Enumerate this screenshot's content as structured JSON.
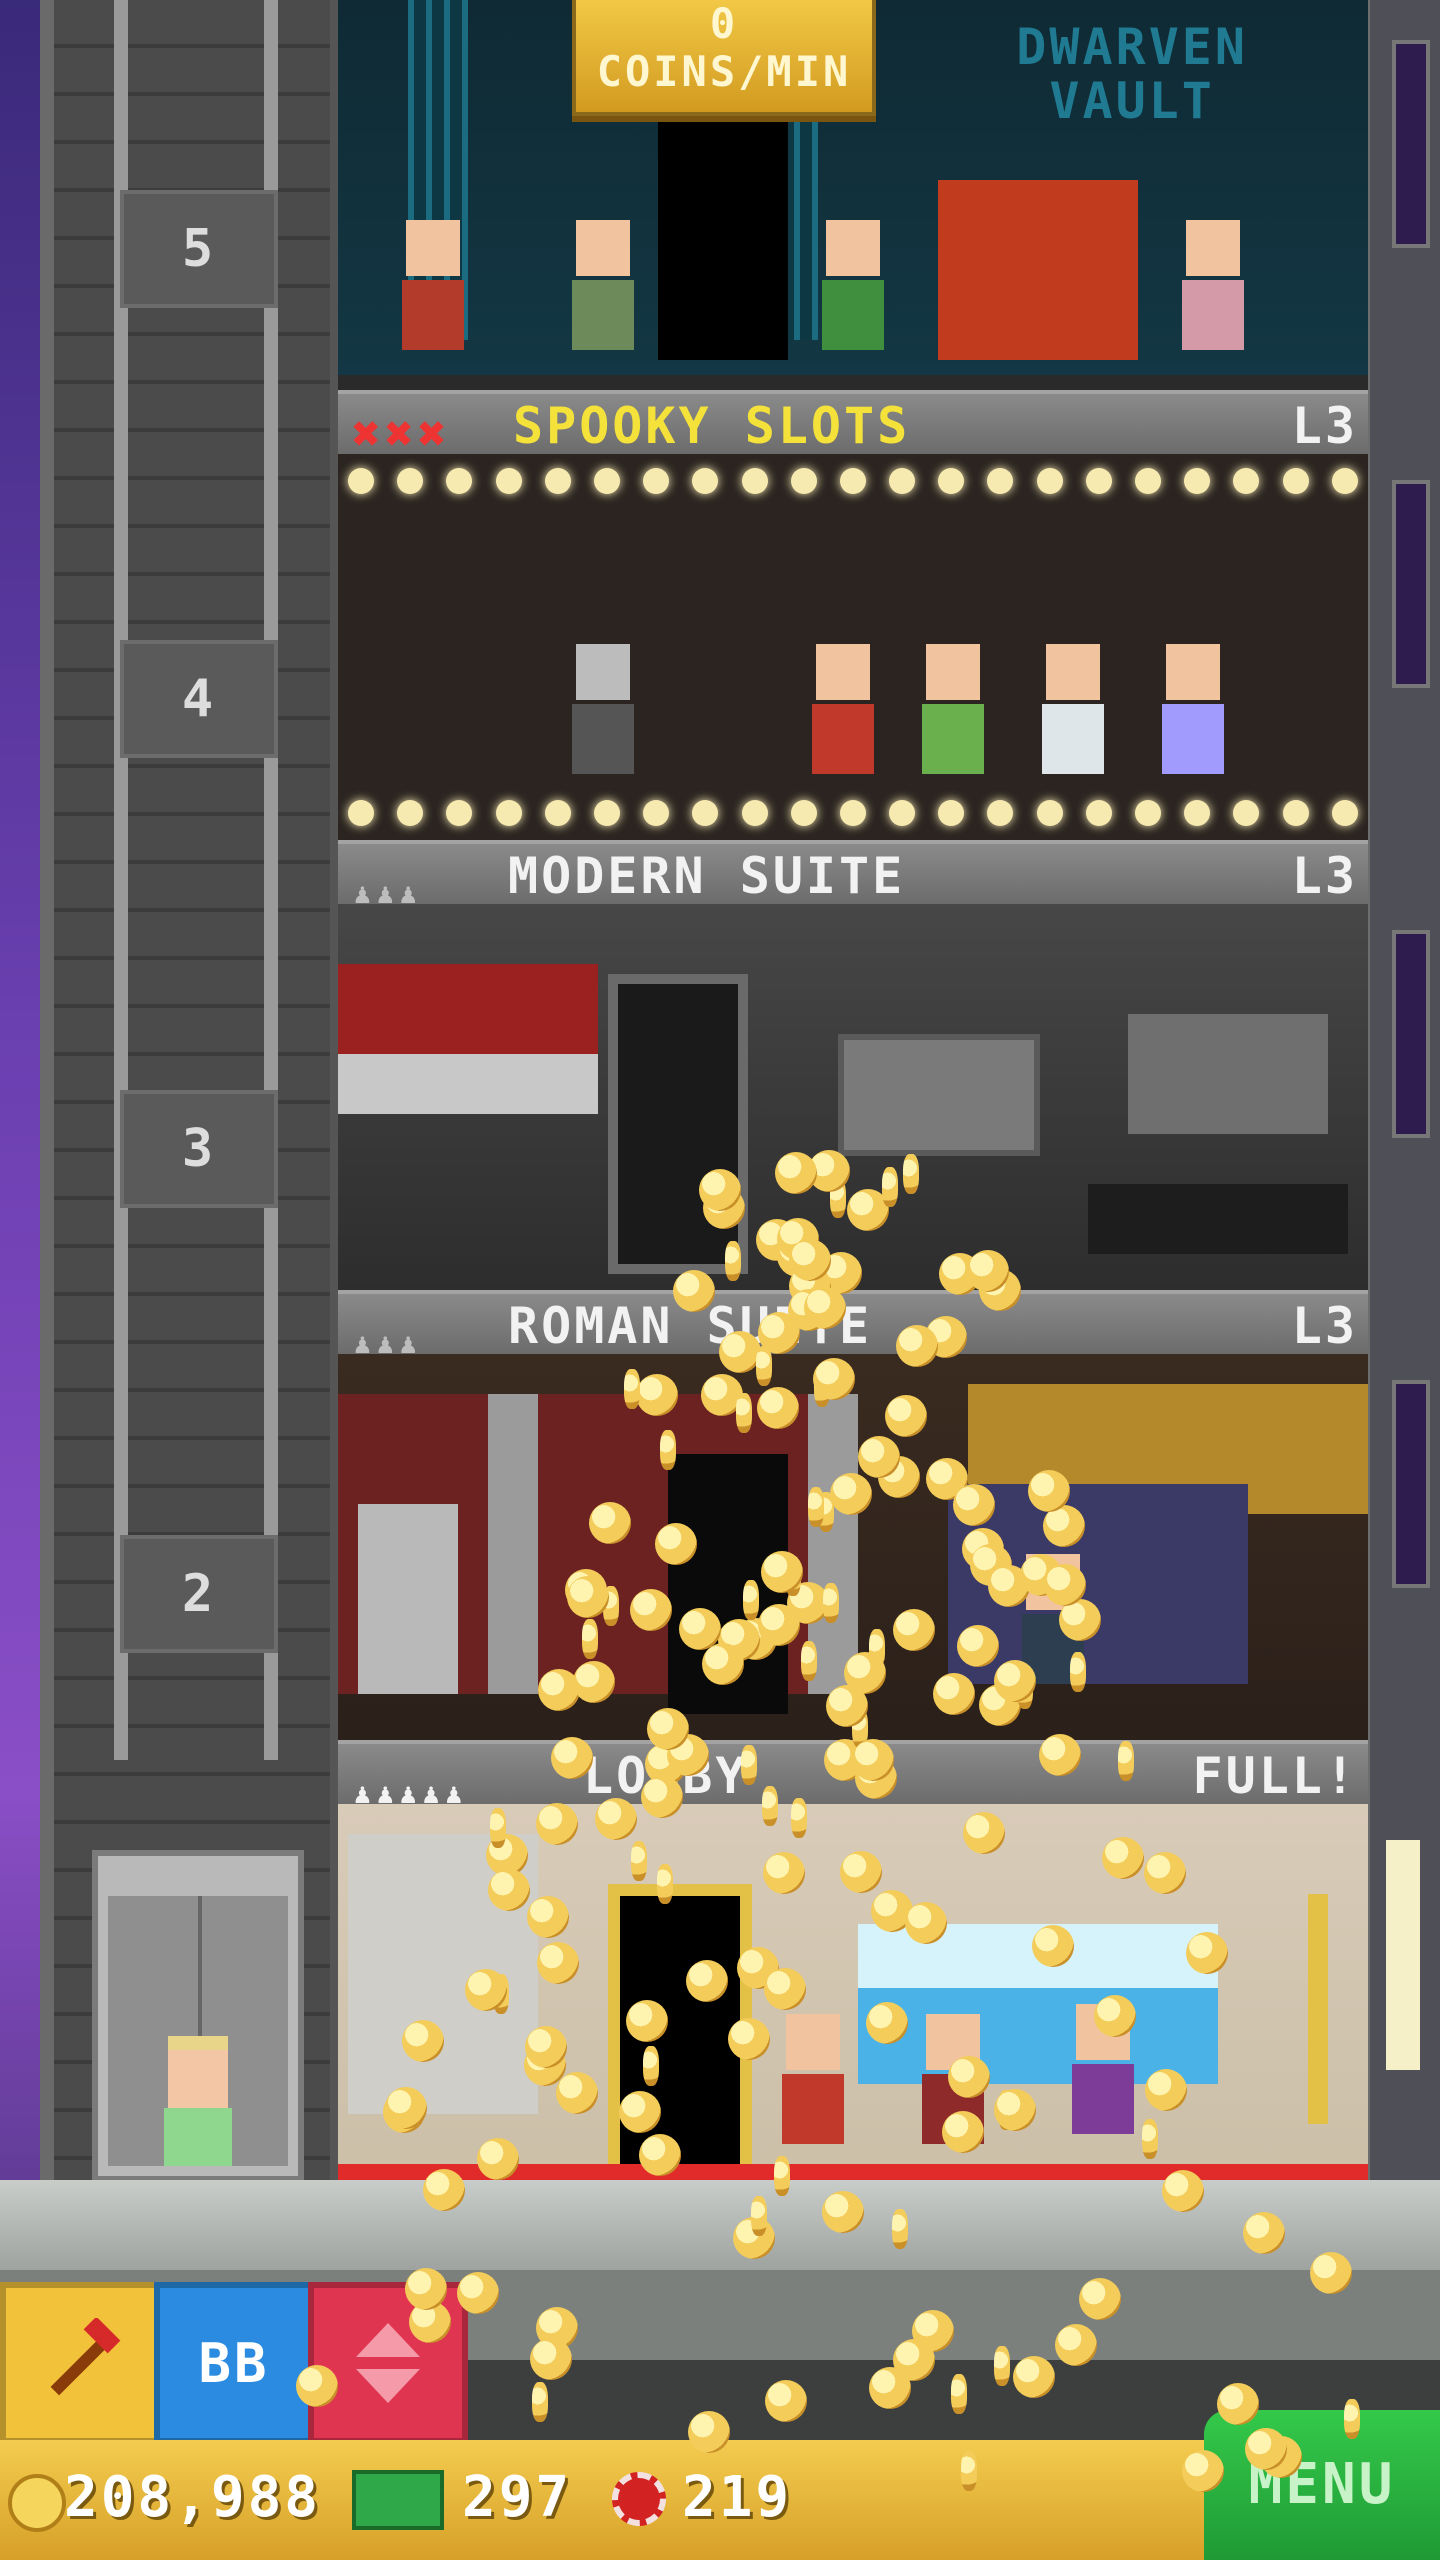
{
  "colors": {
    "gold": "#f2c846",
    "red_star": "#e33333",
    "menu_green": "#34c94a",
    "bb_blue": "#2a8be0",
    "elevator_red": "#e03550"
  },
  "header": {
    "coins_per_min_value": "0",
    "coins_per_min_label": "COINS/MIN"
  },
  "vault": {
    "sign_line1": "DWARVEN",
    "sign_line2": "VAULT"
  },
  "elevator": {
    "floors": [
      "5",
      "4",
      "3",
      "2"
    ]
  },
  "rooms": {
    "spooky_slots": {
      "name": "SPOOKY SLOTS",
      "level": "L3",
      "stars": "✖✖✖"
    },
    "modern_suite": {
      "name": "MODERN SUITE",
      "level": "L3",
      "occupants": "♟♟♟"
    },
    "roman_suite": {
      "name": "ROMAN SUITE",
      "level": "L3",
      "occupants": "♟♟♟"
    },
    "lobby": {
      "name": "LOBBY",
      "status": "FULL!",
      "occupants": "♟♟♟♟♟"
    }
  },
  "actions": {
    "hammer_icon": "hammer-icon",
    "bb_label": "BB",
    "elevator_icon": "elevator-arrows-icon"
  },
  "stats": {
    "coins": "208,988",
    "bux": "297",
    "chips": "219"
  },
  "menu": {
    "label": "MENU"
  }
}
